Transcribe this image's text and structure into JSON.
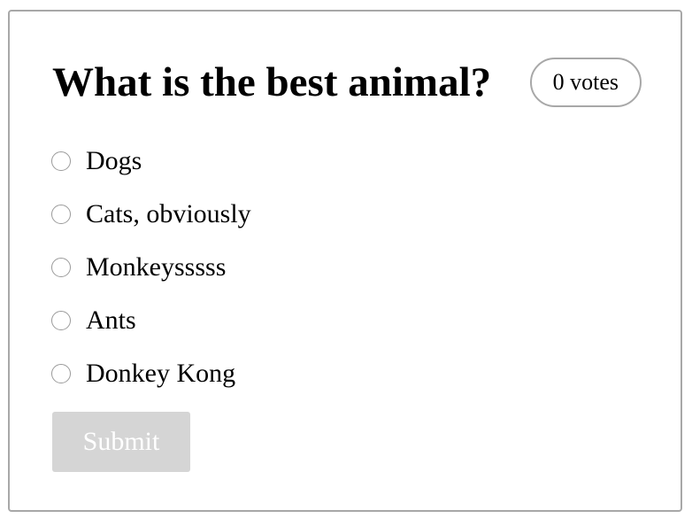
{
  "poll": {
    "question": "What is the best animal?",
    "vote_count": "0 votes",
    "options": [
      {
        "label": "Dogs",
        "selected": false
      },
      {
        "label": "Cats, obviously",
        "selected": false
      },
      {
        "label": "Monkeysssss",
        "selected": false
      },
      {
        "label": "Ants",
        "selected": false
      },
      {
        "label": "Donkey Kong",
        "selected": false
      }
    ],
    "submit_label": "Submit",
    "submit_enabled": false
  },
  "colors": {
    "border": "#a8a8a8",
    "submit_disabled_bg": "#d5d5d5",
    "submit_text": "#ffffff"
  }
}
